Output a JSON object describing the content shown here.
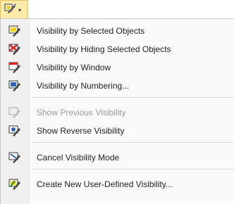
{
  "toolbar": {
    "trigger_icon": "visibility-icon",
    "caret_glyph": "▾"
  },
  "menu": {
    "groups": [
      {
        "items": [
          {
            "label": "Visibility by Selected Objects",
            "icon": "visibility-selected-objects-icon",
            "enabled": true
          },
          {
            "label": "Visibility by Hiding Selected Objects",
            "icon": "visibility-hiding-selected-icon",
            "enabled": true
          },
          {
            "label": "Visibility by Window",
            "icon": "visibility-window-icon",
            "enabled": true
          },
          {
            "label": "Visibility by Numbering...",
            "icon": "visibility-numbering-icon",
            "enabled": true
          }
        ]
      },
      {
        "items": [
          {
            "label": "Show Previous Visibility",
            "icon": "show-previous-visibility-icon",
            "enabled": false
          },
          {
            "label": "Show Reverse Visibility",
            "icon": "show-reverse-visibility-icon",
            "enabled": true
          }
        ]
      },
      {
        "items": [
          {
            "label": "Cancel Visibility Mode",
            "icon": "cancel-visibility-mode-icon",
            "enabled": true
          }
        ]
      },
      {
        "items": [
          {
            "label": "Create New User-Defined Visibility...",
            "icon": "create-user-visibility-icon",
            "enabled": true
          }
        ]
      }
    ]
  },
  "colors": {
    "accent_yellow": "#f5d21f",
    "accent_red": "#d92121",
    "accent_blue": "#2b63c6",
    "disabled_text": "#9a9a9a"
  }
}
